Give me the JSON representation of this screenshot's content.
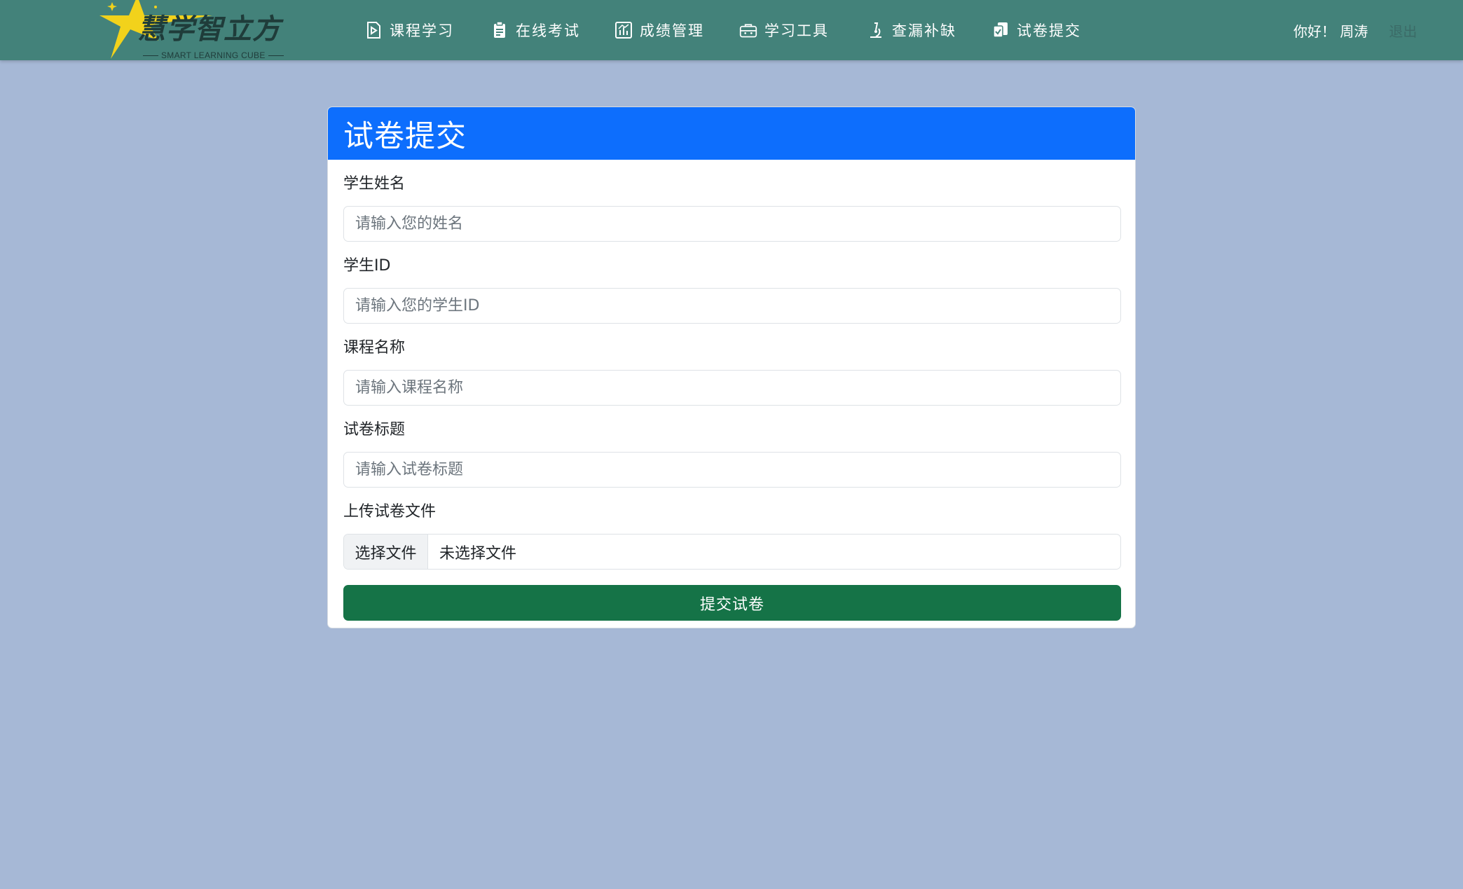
{
  "navbar": {
    "logo": {
      "brand": "慧学智立方",
      "tagline": "SMART LEARNING CUBE"
    },
    "items": [
      {
        "label": "课程学习",
        "icon": "play-document-icon"
      },
      {
        "label": "在线考试",
        "icon": "clipboard-icon"
      },
      {
        "label": "成绩管理",
        "icon": "bar-chart-icon"
      },
      {
        "label": "学习工具",
        "icon": "toolbox-icon"
      },
      {
        "label": "查漏补缺",
        "icon": "microscope-icon"
      },
      {
        "label": "试卷提交",
        "icon": "document-submit-icon"
      }
    ],
    "greeting": "你好！ 周涛",
    "logout_label": "退出"
  },
  "form": {
    "title": "试卷提交",
    "fields": [
      {
        "label": "学生姓名",
        "placeholder": "请输入您的姓名",
        "value": ""
      },
      {
        "label": "学生ID",
        "placeholder": "请输入您的学生ID",
        "value": ""
      },
      {
        "label": "课程名称",
        "placeholder": "请输入课程名称",
        "value": ""
      },
      {
        "label": "试卷标题",
        "placeholder": "请输入试卷标题",
        "value": ""
      }
    ],
    "file": {
      "label": "上传试卷文件",
      "button_label": "选择文件",
      "status": "未选择文件"
    },
    "submit_label": "提交试卷"
  },
  "colors": {
    "navbar": "#43827a",
    "page_background": "#a6b8d6",
    "card_header": "#0d6efd",
    "submit_button": "#157347",
    "logo_star": "#f2d21b"
  }
}
